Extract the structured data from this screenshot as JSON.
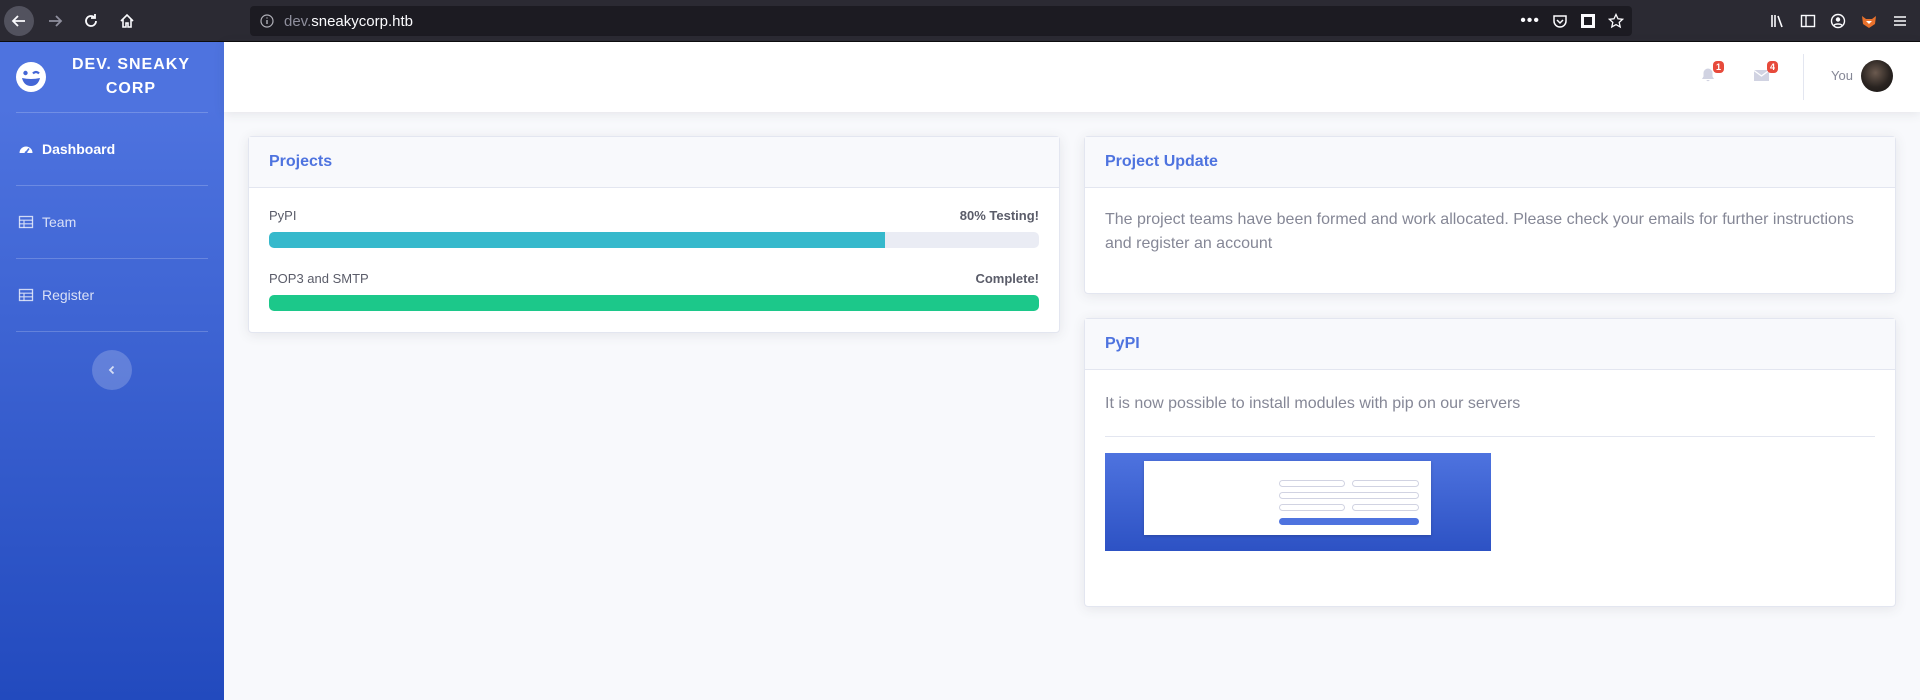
{
  "browser": {
    "url_prefix": "dev.",
    "url_domain": "sneakycorp.htb"
  },
  "sidebar": {
    "brand": "DEV. SNEAKY CORP",
    "items": [
      {
        "label": "Dashboard",
        "active": true
      },
      {
        "label": "Team",
        "active": false
      },
      {
        "label": "Register",
        "active": false
      }
    ]
  },
  "topbar": {
    "alerts_count": "1",
    "messages_count": "4",
    "user_name": "You"
  },
  "projects": {
    "title": "Projects",
    "items": [
      {
        "name": "PyPI",
        "status": "80% Testing!",
        "progress": 80,
        "color": "#36b9cc"
      },
      {
        "name": "POP3 and SMTP",
        "status": "Complete!",
        "progress": 100,
        "color": "#1cc88a"
      }
    ]
  },
  "update": {
    "title": "Project Update",
    "text": "The project teams have been formed and work allocated. Please check your emails for further instructions and register an account"
  },
  "pypi": {
    "title": "PyPI",
    "text": "It is now possible to install modules with pip on our servers"
  },
  "colors": {
    "primary": "#4e73df",
    "info": "#36b9cc",
    "success": "#1cc88a",
    "danger": "#e74a3b"
  }
}
